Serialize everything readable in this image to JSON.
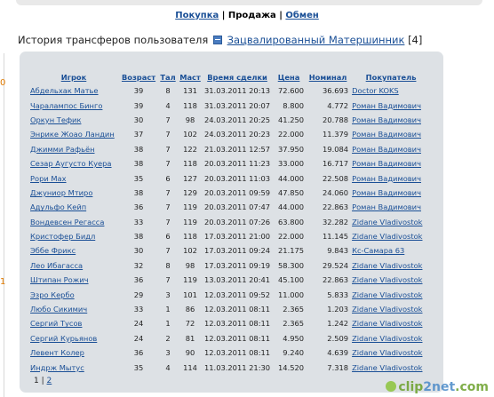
{
  "nav": {
    "buy": "Покупка",
    "sep1": "|",
    "sell": "Продажа",
    "sep2": "|",
    "exchange": "Обмен"
  },
  "history": {
    "label": "История трансферов пользователя",
    "user": "Зацвалированный Матершинник",
    "count": "[4]"
  },
  "table": {
    "headers": [
      "Игрок",
      "Возраст",
      "Тал",
      "Маст",
      "Время сделки",
      "Цена",
      "Номинал",
      "Покупатель"
    ],
    "rows": [
      [
        "Абдельхак Матье",
        "39",
        "8",
        "131",
        "31.03.2011 20:13",
        "72.600",
        "36.693",
        "Doctor KOKS"
      ],
      [
        "Чаралампос Бинго",
        "39",
        "4",
        "118",
        "31.03.2011 20:07",
        "8.800",
        "4.772",
        "Роман Вадимович"
      ],
      [
        "Оркун Тефик",
        "30",
        "7",
        "98",
        "24.03.2011 20:25",
        "41.250",
        "20.788",
        "Роман Вадимович"
      ],
      [
        "Энрике Жоао Ландин",
        "37",
        "7",
        "102",
        "24.03.2011 20:23",
        "22.000",
        "11.379",
        "Роман Вадимович"
      ],
      [
        "Джимми Рафьён",
        "38",
        "7",
        "122",
        "21.03.2011 12:57",
        "37.950",
        "19.084",
        "Роман Вадимович"
      ],
      [
        "Сезар Аугусто Куера",
        "38",
        "7",
        "118",
        "20.03.2011 11:23",
        "33.000",
        "16.717",
        "Роман Вадимович"
      ],
      [
        "Рори Мах",
        "35",
        "6",
        "127",
        "20.03.2011 11:03",
        "44.000",
        "22.508",
        "Роман Вадимович"
      ],
      [
        "Джуниор Мтиро",
        "38",
        "7",
        "129",
        "20.03.2011 09:59",
        "47.850",
        "24.060",
        "Роман Вадимович"
      ],
      [
        "Адульфо Кейп",
        "36",
        "7",
        "119",
        "20.03.2011 07:47",
        "44.000",
        "22.863",
        "Роман Вадимович"
      ],
      [
        "Вондевсен Регасса",
        "33",
        "7",
        "119",
        "20.03.2011 07:26",
        "63.800",
        "32.282",
        "Zidane Vladivostok"
      ],
      [
        "Кристофер Бидл",
        "38",
        "6",
        "118",
        "17.03.2011 21:00",
        "22.000",
        "11.145",
        "Zidane Vladivostok"
      ],
      [
        "Эббе Фрикс",
        "30",
        "7",
        "102",
        "17.03.2011 09:24",
        "21.175",
        "9.843",
        "Кс-Самара 63"
      ],
      [
        "Лео Ибагасса",
        "32",
        "8",
        "98",
        "17.03.2011 09:19",
        "58.300",
        "29.524",
        "Zidane Vladivostok"
      ],
      [
        "Штипан Рожич",
        "36",
        "7",
        "119",
        "13.03.2011 20:41",
        "45.100",
        "22.863",
        "Zidane Vladivostok"
      ],
      [
        "Эзро Кербо",
        "29",
        "3",
        "101",
        "12.03.2011 09:52",
        "11.000",
        "5.833",
        "Zidane Vladivostok"
      ],
      [
        "Любо Сикимич",
        "33",
        "1",
        "86",
        "12.03.2011 08:11",
        "2.365",
        "1.203",
        "Zidane Vladivostok"
      ],
      [
        "Сергий Тусов",
        "24",
        "1",
        "72",
        "12.03.2011 08:11",
        "2.365",
        "1.242",
        "Zidane Vladivostok"
      ],
      [
        "Сергий Курьянов",
        "24",
        "2",
        "81",
        "12.03.2011 08:11",
        "4.950",
        "2.509",
        "Zidane Vladivostok"
      ],
      [
        "Левент Колер",
        "36",
        "3",
        "90",
        "12.03.2011 08:11",
        "9.240",
        "4.639",
        "Zidane Vladivostok"
      ],
      [
        "Индрж Мытус",
        "35",
        "4",
        "114",
        "11.03.2011 21:30",
        "14.520",
        "7.318",
        "Zidane Vladivostok"
      ]
    ]
  },
  "pager": {
    "current": "1",
    "sep": "|",
    "next": "2"
  },
  "watermark": {
    "a": "clip",
    "b": "2net",
    "c": ".com"
  },
  "colors": {
    "link": "#1a4f96",
    "panel": "#dde1e5"
  }
}
